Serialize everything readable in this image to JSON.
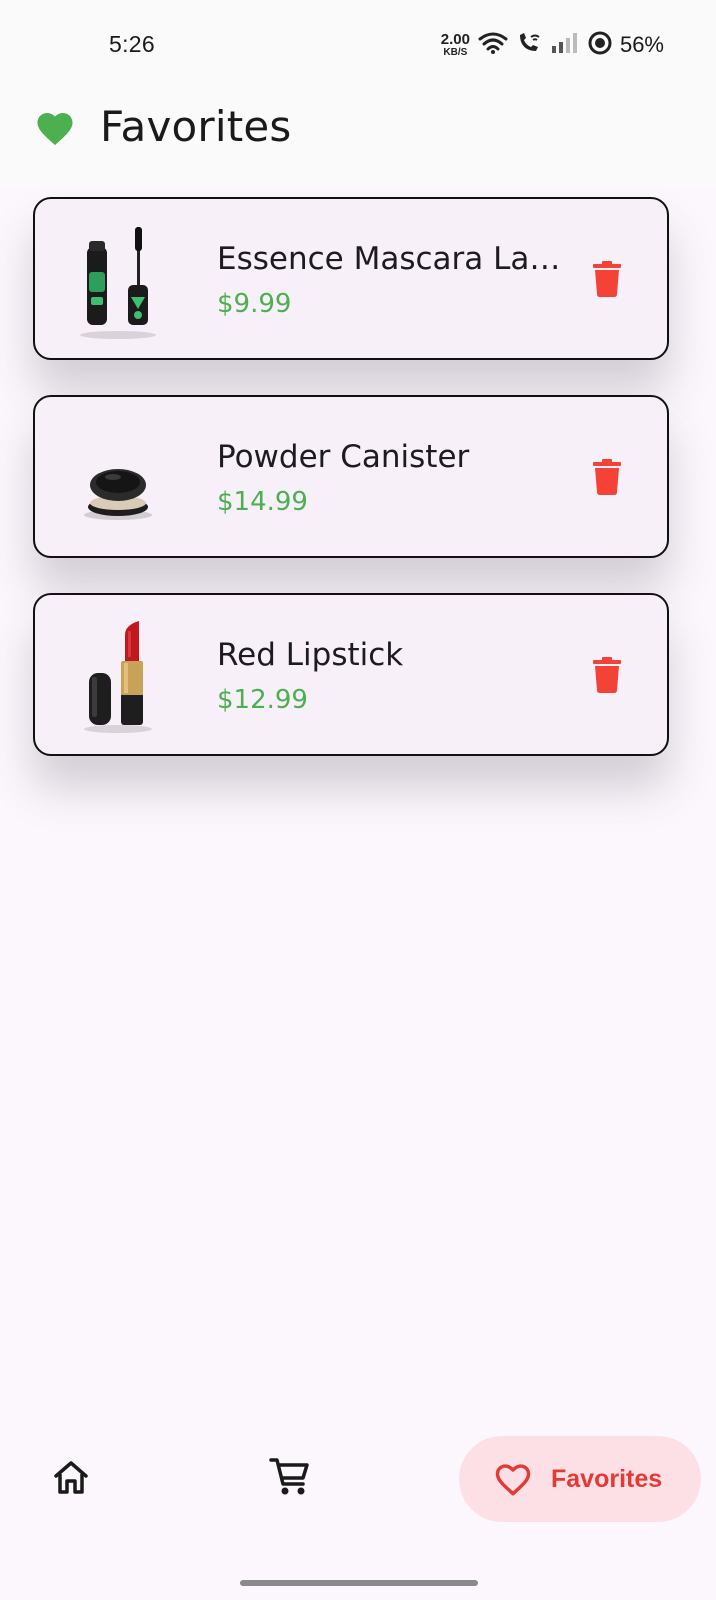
{
  "status_bar": {
    "time": "5:26",
    "net_speed_value": "2.00",
    "net_speed_unit": "KB/S",
    "battery": "56%",
    "icons": [
      "wifi-icon",
      "wifi-calling-icon",
      "signal-icon",
      "battery-ring-icon"
    ]
  },
  "header": {
    "title": "Favorites",
    "icon": "heart-icon",
    "icon_color": "#4caf50"
  },
  "favorites": [
    {
      "name": "Essence Mascara Lash Princess",
      "price": "$9.99",
      "thumb_icon": "mascara-image"
    },
    {
      "name": "Powder Canister",
      "price": "$14.99",
      "thumb_icon": "powder-compact-image"
    },
    {
      "name": "Red Lipstick",
      "price": "$12.99",
      "thumb_icon": "lipstick-image"
    }
  ],
  "bottom_nav": {
    "home_icon": "home-icon",
    "cart_icon": "cart-icon",
    "favorites_label": "Favorites",
    "favorites_icon": "heart-outline-icon"
  },
  "colors": {
    "accent_green": "#4caf50",
    "delete_red": "#f44336",
    "nav_active_bg": "#fde0e5",
    "nav_active_fg": "#e53935"
  }
}
